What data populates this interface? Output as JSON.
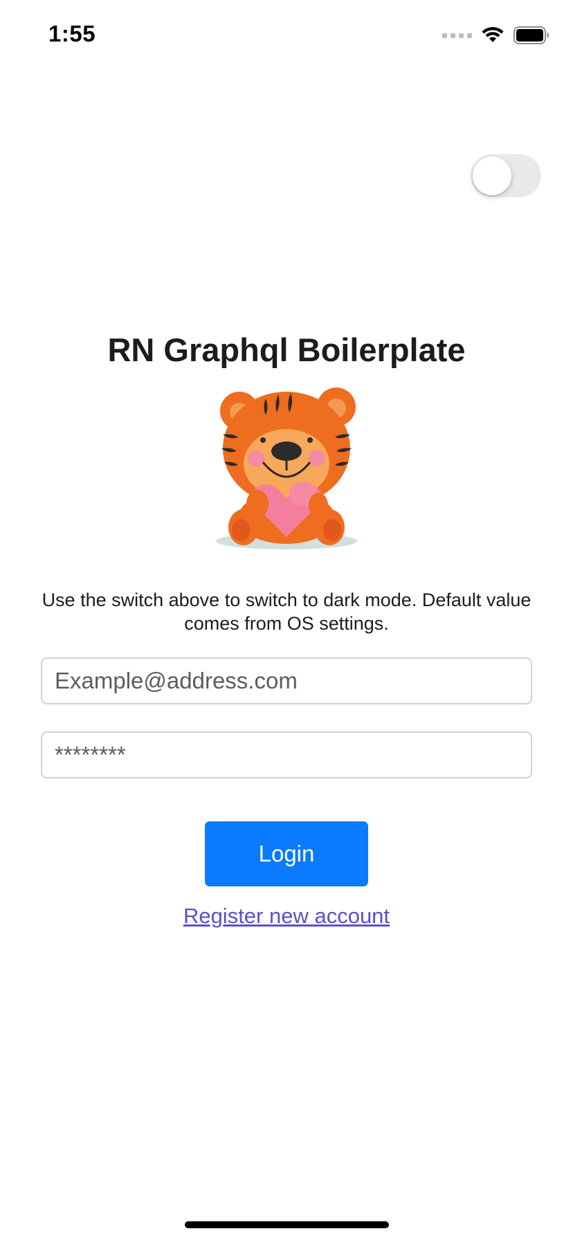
{
  "status_bar": {
    "time": "1:55",
    "signal_icon": "cellular-signal-icon",
    "wifi_icon": "wifi-icon",
    "battery_icon": "battery-icon"
  },
  "theme_switch": {
    "state": "off"
  },
  "app": {
    "title": "RN Graphql Boilerplate",
    "mascot_icon": "tiger-mascot-icon",
    "hint": "Use the switch above to switch to dark mode. Default value comes from OS settings."
  },
  "login_form": {
    "email_placeholder": "Example@address.com",
    "password_placeholder": "********",
    "login_label": "Login",
    "register_label": "Register new account"
  },
  "colors": {
    "accent": "#0a7aff",
    "link": "#5b4fcf",
    "switch_track": "#e9e9eb"
  }
}
